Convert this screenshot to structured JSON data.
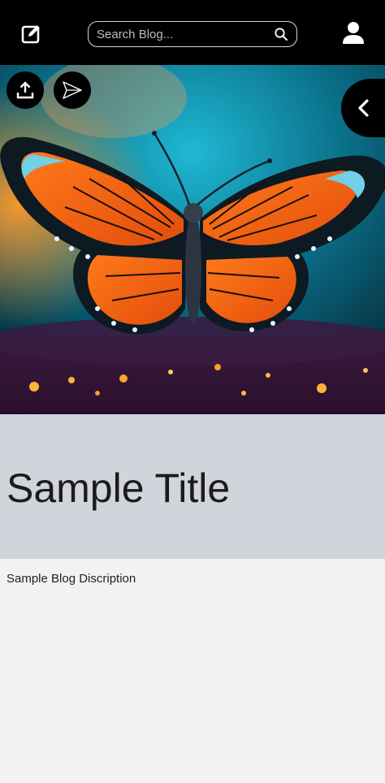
{
  "header": {
    "search": {
      "placeholder": "Search Blog..."
    },
    "icons": {
      "compose": "edit-icon",
      "search": "search-icon",
      "account": "user-icon"
    }
  },
  "hero": {
    "image": "butterfly-photo",
    "actions": {
      "upload": "upload-icon",
      "send": "send-icon",
      "back": "chevron-left-icon"
    }
  },
  "post": {
    "title": "Sample Title",
    "description": "Sample Blog Discription"
  }
}
